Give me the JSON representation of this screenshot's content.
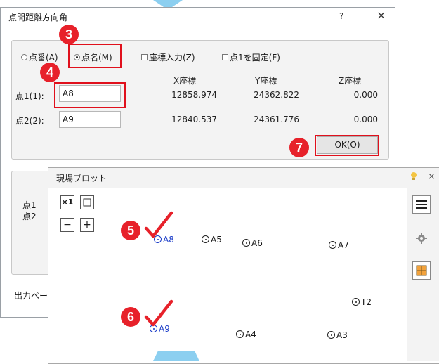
{
  "dialog": {
    "title": "点間距離方向角",
    "help": "?",
    "close": "×",
    "options": {
      "point_number": "点番(A)",
      "point_name": "点名(M)",
      "coord_input": "座標入力(Z)",
      "fix_point1": "点1を固定(F)"
    },
    "columns": {
      "x": "X座標",
      "y": "Y座標",
      "z": "Z座標"
    },
    "rows": [
      {
        "label": "点1(1):",
        "value": "A8",
        "x": "12858.974",
        "y": "24362.822",
        "z": "0.000"
      },
      {
        "label": "点2(2):",
        "value": "A9",
        "x": "12840.537",
        "y": "24361.776",
        "z": "0.000"
      }
    ],
    "ok_label": "OK(O)",
    "lower": {
      "point1": "点1",
      "point2": "点2",
      "output_page": "出力ペー:"
    }
  },
  "badges": [
    "3",
    "4",
    "5",
    "6",
    "7"
  ],
  "plot": {
    "title": "現場プロット",
    "close": "×",
    "toolbar": {
      "zoom_1x": "×1",
      "zoom_out": "−",
      "zoom_in": "+"
    },
    "points": [
      {
        "name": "A8",
        "selected": true
      },
      {
        "name": "A5",
        "selected": false
      },
      {
        "name": "A6",
        "selected": false
      },
      {
        "name": "A7",
        "selected": false
      },
      {
        "name": "T2",
        "selected": false
      },
      {
        "name": "A9",
        "selected": true
      },
      {
        "name": "A4",
        "selected": false
      },
      {
        "name": "A3",
        "selected": false
      }
    ]
  },
  "colors": {
    "accent": "#e7212a",
    "selected": "#1a3cc8",
    "arrow": "#8ccff0"
  }
}
